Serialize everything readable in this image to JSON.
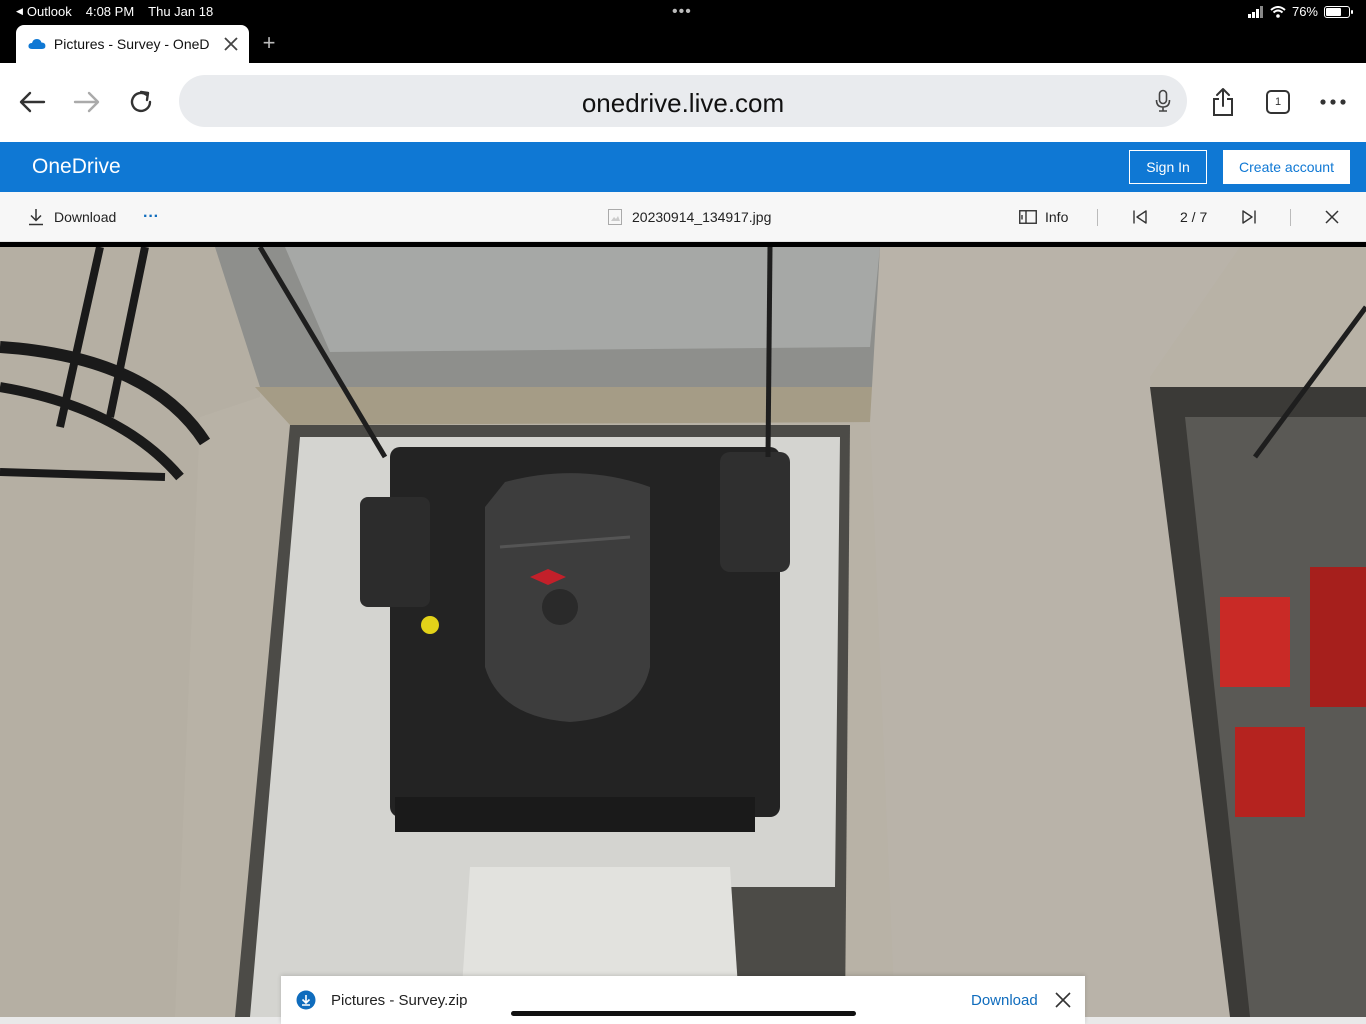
{
  "status_bar": {
    "back_app": "Outlook",
    "time": "4:08 PM",
    "date": "Thu Jan 18",
    "battery": "76%",
    "battery_level": 0.76
  },
  "browser": {
    "tab_title": "Pictures - Survey - OneD",
    "url": "onedrive.live.com",
    "tab_count": "1"
  },
  "onedrive": {
    "brand": "OneDrive",
    "sign_in": "Sign In",
    "create_account": "Create account"
  },
  "viewer": {
    "download_label": "Download",
    "more_label": "···",
    "file_name": "20230914_134917.jpg",
    "info_label": "Info",
    "page_counter": "2 / 7"
  },
  "download_banner": {
    "file_name": "Pictures - Survey.zip",
    "action_label": "Download"
  },
  "colors": {
    "onedrive_blue": "#0f78d4",
    "link_blue": "#0f6cbd"
  }
}
